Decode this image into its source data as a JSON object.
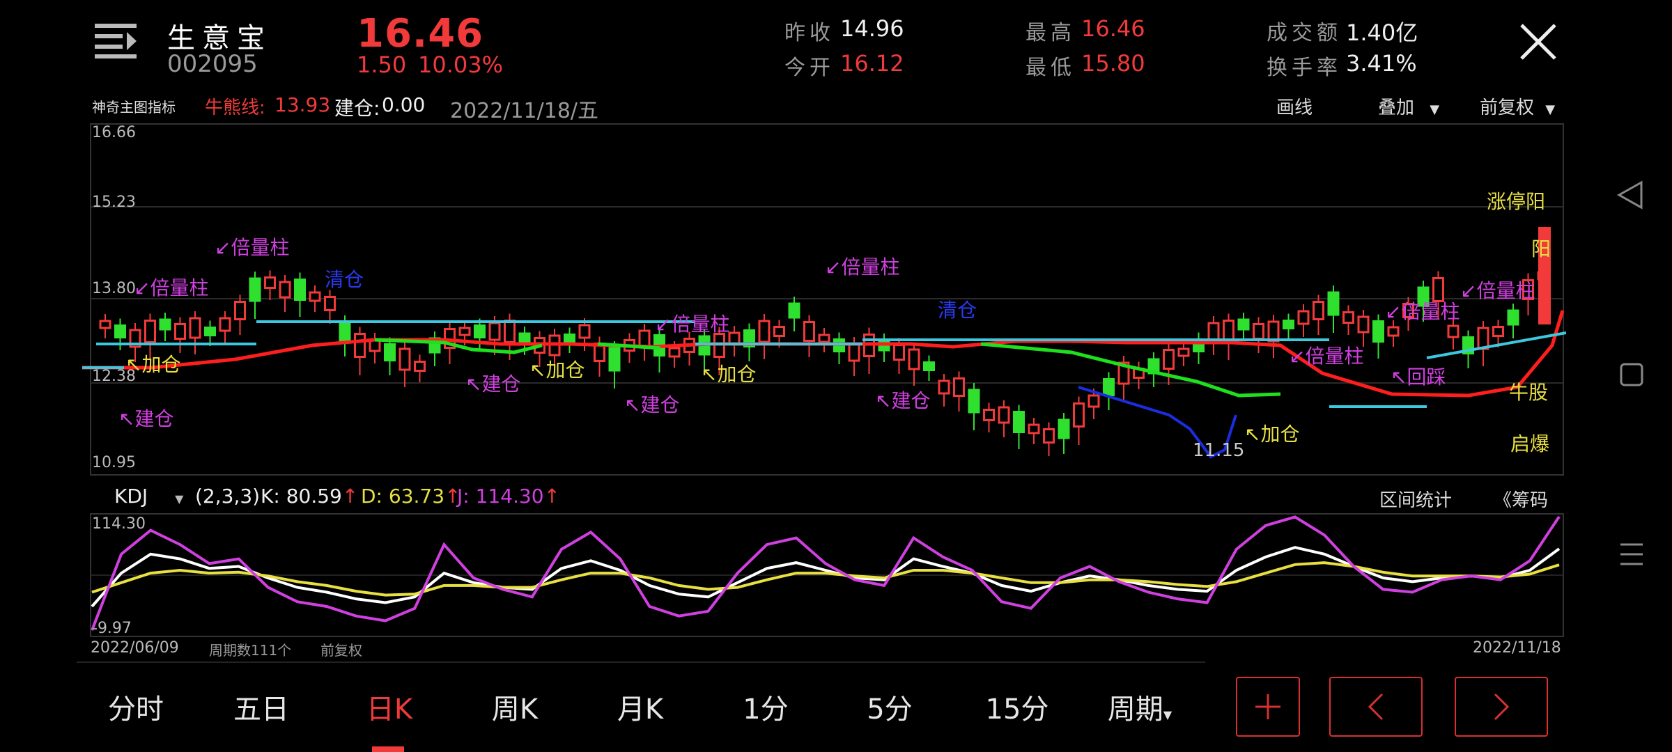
{
  "header": {
    "name": "生意宝",
    "code": "002095",
    "price": "16.46",
    "change": "1.50",
    "change_pct": "10.03%",
    "stats": {
      "prev_close_label": "昨收",
      "prev_close": "14.96",
      "open_label": "今开",
      "open": "16.12",
      "high_label": "最高",
      "high": "16.46",
      "low_label": "最低",
      "low": "15.80",
      "turnover_label": "成交额",
      "turnover": "1.40亿",
      "turnover_rate_label": "换手率",
      "turnover_rate": "3.41%"
    }
  },
  "indicator_bar": {
    "name": "神奇主图指标",
    "bull_bear_label": "牛熊线:",
    "bull_bear_value": "13.93",
    "build_label": "建仓:",
    "build_value": "0.00",
    "date": "2022/11/18/五",
    "draw": "画线",
    "overlay": "叠加",
    "adjust": "前复权"
  },
  "main_chart": {
    "y_labels": [
      "16.66",
      "15.23",
      "13.80",
      "12.38",
      "10.95"
    ],
    "low_marker": "11.15",
    "signals": {
      "bei_liang_zhu": "倍量柱",
      "jia_cang": "加仓",
      "jian_cang": "建仓",
      "qing_cang": "清仓",
      "hui_cai": "回踩",
      "qi_bao": "启爆",
      "niu": "牛股",
      "zhang_ting": "涨停阳",
      "big_yang": "阳"
    }
  },
  "kdj": {
    "name": "KDJ",
    "params": "(2,3,3)",
    "k_label": "K: 80.59",
    "d_label": "D: 63.73",
    "j_label": "J: 114.30",
    "range_stats": "区间统计",
    "chips": "《筹码",
    "y_top": "114.30",
    "y_bottom": "-9.97"
  },
  "footer_info": {
    "start_date": "2022/06/09",
    "periods": "周期数111个",
    "adjust": "前复权",
    "end_date": "2022/11/18"
  },
  "tabs": [
    "分时",
    "五日",
    "日K",
    "周K",
    "月K",
    "1分",
    "5分",
    "15分",
    "周期"
  ],
  "active_tab": "日K",
  "colors": {
    "up": "#f23a3a",
    "down": "#2fe02f",
    "cyan": "#3ec8e0",
    "magenta": "#d040e0",
    "yellow": "#e8e040",
    "kdj_k": "#ffffff",
    "kdj_d": "#e8e040",
    "kdj_j": "#d040e0"
  },
  "chart_data": {
    "type": "line",
    "name": "KDJ",
    "x_range": [
      "2022/06/09",
      "2022/11/18"
    ],
    "ylim": [
      -9.97,
      114.3
    ],
    "series": [
      {
        "name": "K",
        "values": [
          20,
          55,
          75,
          70,
          60,
          62,
          50,
          40,
          35,
          28,
          24,
          30,
          55,
          45,
          40,
          38,
          60,
          68,
          58,
          42,
          33,
          30,
          45,
          60,
          66,
          58,
          50,
          48,
          70,
          62,
          55,
          42,
          36,
          45,
          52,
          48,
          42,
          38,
          36,
          58,
          72,
          82,
          75,
          62,
          50,
          46,
          50,
          52,
          50,
          58,
          80.59
        ]
      },
      {
        "name": "D",
        "values": [
          35,
          45,
          55,
          58,
          55,
          56,
          52,
          46,
          42,
          36,
          32,
          33,
          42,
          42,
          40,
          40,
          48,
          55,
          55,
          50,
          42,
          38,
          40,
          48,
          55,
          55,
          52,
          50,
          58,
          58,
          55,
          50,
          45,
          45,
          48,
          48,
          46,
          43,
          41,
          46,
          55,
          64,
          66,
          62,
          56,
          52,
          52,
          52,
          51,
          54,
          63.73
        ]
      },
      {
        "name": "J",
        "values": [
          -5,
          75,
          100,
          85,
          65,
          70,
          40,
          25,
          20,
          10,
          5,
          18,
          85,
          50,
          38,
          30,
          80,
          98,
          70,
          20,
          10,
          15,
          55,
          85,
          92,
          65,
          48,
          42,
          92,
          72,
          58,
          25,
          18,
          50,
          62,
          46,
          35,
          28,
          24,
          80,
          105,
          114,
          95,
          62,
          38,
          35,
          48,
          52,
          48,
          68,
          114.3
        ]
      }
    ]
  }
}
